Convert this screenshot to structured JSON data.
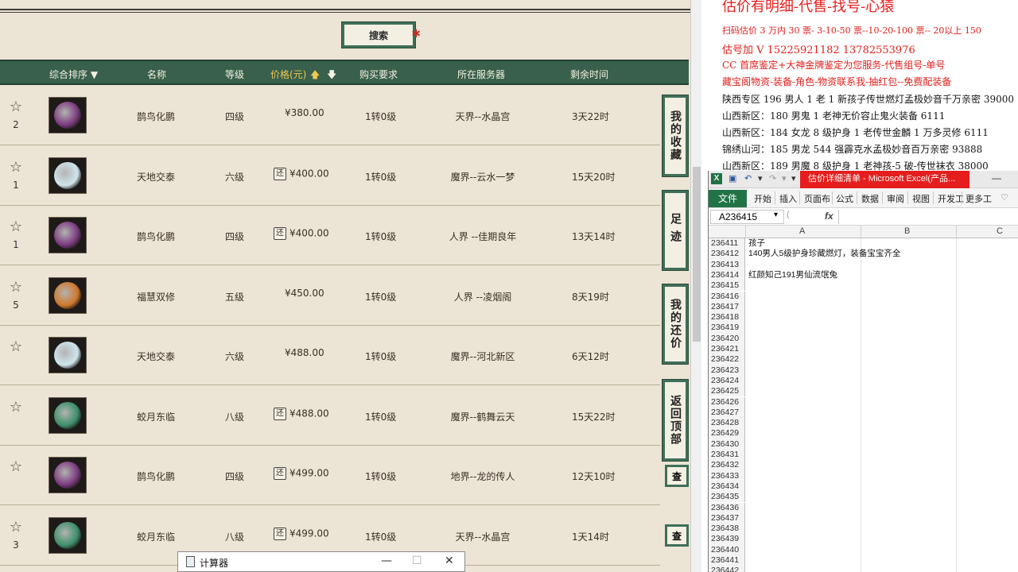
{
  "search_label": "搜索",
  "table_headers": [
    "综合排序 ▼",
    "名称",
    "等级",
    "价格(元)",
    "购买要求",
    "所在服务器",
    "剩余时间"
  ],
  "price_up_icon": "arrow-up-icon",
  "price_down_icon": "arrow-down-icon",
  "rows": [
    {
      "fav": "2",
      "name": "鹊鸟化鹏",
      "level": "四级",
      "price": "¥380.00",
      "bargain": "",
      "req": "1转0级",
      "server": "天界--水晶宫",
      "time": "3天22时",
      "orb": "#7a3a7e"
    },
    {
      "fav": "1",
      "name": "天地交泰",
      "level": "六级",
      "price": "¥400.00",
      "bargain": "还",
      "req": "1转0级",
      "server": "魔界--云水一梦",
      "time": "15天20时",
      "orb": "#cfe6ec"
    },
    {
      "fav": "1",
      "name": "鹊鸟化鹏",
      "level": "四级",
      "price": "¥400.00",
      "bargain": "还",
      "req": "1转0级",
      "server": "人界 --佳期良年",
      "time": "13天14时",
      "orb": "#7a3a7e"
    },
    {
      "fav": "5",
      "name": "福慧双修",
      "level": "五级",
      "price": "¥450.00",
      "bargain": "",
      "req": "1转0级",
      "server": "人界 --凌烟阁",
      "time": "8天19时",
      "orb": "#d0782a"
    },
    {
      "fav": "",
      "name": "天地交泰",
      "level": "六级",
      "price": "¥488.00",
      "bargain": "",
      "req": "1转0级",
      "server": "魔界--河北新区",
      "time": "6天12时",
      "orb": "#cfe6ec"
    },
    {
      "fav": "",
      "name": "蛟月东临",
      "level": "八级",
      "price": "¥488.00",
      "bargain": "还",
      "req": "1转0级",
      "server": "魔界--鹤舞云天",
      "time": "15天22时",
      "orb": "#3c8f6a"
    },
    {
      "fav": "",
      "name": "鹊鸟化鹏",
      "level": "四级",
      "price": "¥499.00",
      "bargain": "还",
      "req": "1转0级",
      "server": "地界--龙的传人",
      "time": "12天10时",
      "orb": "#7a3a7e"
    },
    {
      "fav": "3",
      "name": "蛟月东临",
      "level": "八级",
      "price": "¥499.00",
      "bargain": "还",
      "req": "1转0级",
      "server": "天界--水晶宫",
      "time": "1天14时",
      "orb": "#3c8f6a"
    }
  ],
  "side_buttons": [
    "我的收藏",
    "足迹",
    "我的还价",
    "返回顶部"
  ],
  "small_btn_label": "查",
  "calculator": {
    "title": "计算器",
    "min": "—",
    "max": "☐",
    "close": "✕"
  },
  "ad": {
    "title": "估价有明细-代售-找号-心猿",
    "line1": "扫码估价 3 万内 30 票- 3-10-50 票--10-20-100 票-- 20以上 150",
    "line2": "估号加 V 15225921182   13782553976",
    "line3": "CC 首席鉴定+大神金牌鉴定为您服务-代售组号-单号",
    "line4": "藏宝阁物资-装备-角色-物资联系我-抽红包--免费配装备",
    "line5": "陕西专区 196 男人 1 老 1 新孩子传世燃灯孟极妙音千万亲密 39000",
    "line6": "山西新区：180 男鬼 1 老神无价容止鬼火装备 6111",
    "line7": "山西新区：184 女龙 8 级护身 1 老传世金麟 1 万多灵修 6111",
    "line8": "锦绣山河：185 男龙 544 强霹克水孟极妙音百万亲密 93888",
    "line9": "山西新区：189 男魔 8 级护身 1 老神孩-5 破-传世袜衣 38000"
  },
  "excel": {
    "doc_title": "估价详细清单 - Microsoft Excel(产品...",
    "tabs": [
      "开始",
      "插入",
      "页面布",
      "公式",
      "数据",
      "审阅",
      "视图",
      "开发工",
      "更多工"
    ],
    "file_tab": "文件",
    "name_box": "A236415",
    "fx": "fx",
    "columns": [
      "A",
      "B",
      "C"
    ],
    "rows": [
      {
        "n": "236411",
        "a": "孩子"
      },
      {
        "n": "236412",
        "a": "140男人5级护身珍藏燃灯，装备宝宝齐全"
      },
      {
        "n": "236413",
        "a": ""
      },
      {
        "n": "236414",
        "a": "红颜知己191男仙流氓兔"
      },
      {
        "n": "236415",
        "a": ""
      },
      {
        "n": "236416",
        "a": ""
      },
      {
        "n": "236417",
        "a": ""
      },
      {
        "n": "236418",
        "a": ""
      },
      {
        "n": "236419",
        "a": ""
      },
      {
        "n": "236420",
        "a": ""
      },
      {
        "n": "236421",
        "a": ""
      },
      {
        "n": "236422",
        "a": ""
      },
      {
        "n": "236423",
        "a": ""
      },
      {
        "n": "236424",
        "a": ""
      },
      {
        "n": "236425",
        "a": ""
      },
      {
        "n": "236426",
        "a": ""
      },
      {
        "n": "236427",
        "a": ""
      },
      {
        "n": "236428",
        "a": ""
      },
      {
        "n": "236429",
        "a": ""
      },
      {
        "n": "236430",
        "a": ""
      },
      {
        "n": "236431",
        "a": ""
      },
      {
        "n": "236432",
        "a": ""
      },
      {
        "n": "236433",
        "a": ""
      },
      {
        "n": "236434",
        "a": ""
      },
      {
        "n": "236435",
        "a": ""
      },
      {
        "n": "236436",
        "a": ""
      },
      {
        "n": "236437",
        "a": ""
      },
      {
        "n": "236438",
        "a": ""
      },
      {
        "n": "236439",
        "a": ""
      },
      {
        "n": "236440",
        "a": ""
      },
      {
        "n": "236441",
        "a": ""
      },
      {
        "n": "236442",
        "a": ""
      }
    ]
  }
}
